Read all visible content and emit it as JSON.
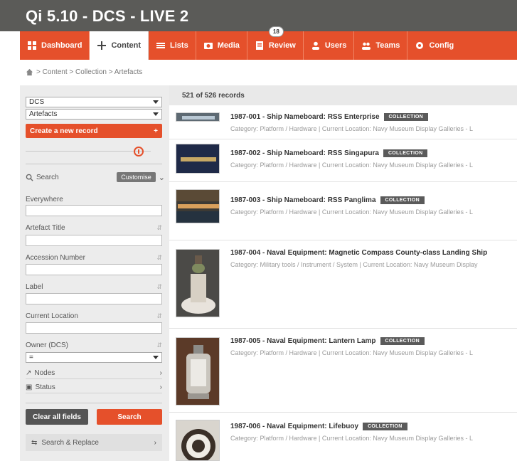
{
  "app": {
    "title": "Qi 5.10 - DCS - LIVE 2"
  },
  "nav": [
    {
      "label": "Dashboard",
      "icon": "dashboard-icon",
      "active": false
    },
    {
      "label": "Content",
      "icon": "plus-icon",
      "active": true
    },
    {
      "label": "Lists",
      "icon": "list-icon",
      "active": false
    },
    {
      "label": "Media",
      "icon": "camera-icon",
      "active": false
    },
    {
      "label": "Review",
      "icon": "review-icon",
      "active": false,
      "badge": "18"
    },
    {
      "label": "Users",
      "icon": "user-icon",
      "active": false
    },
    {
      "label": "Teams",
      "icon": "team-icon",
      "active": false
    },
    {
      "label": "Config",
      "icon": "gear-icon",
      "active": false
    }
  ],
  "breadcrumb": {
    "text": "> Content > Collection > Artefacts"
  },
  "sidebar": {
    "select1": "DCS",
    "select2": "Artefacts",
    "create_button": "Create a new record",
    "create_icon": "+",
    "search_label": "Search",
    "search_mode": "Customise",
    "fields": [
      {
        "label": "Everywhere",
        "sortable": false
      },
      {
        "label": "Artefact Title",
        "sortable": true
      },
      {
        "label": "Accession Number",
        "sortable": true
      },
      {
        "label": "Label",
        "sortable": true
      },
      {
        "label": "Current Location",
        "sortable": true
      }
    ],
    "owner_label": "Owner (DCS)",
    "owner_value": "=",
    "nodes_label": "Nodes",
    "status_label": "Status",
    "clear_button": "Clear all fields",
    "search_button": "Search",
    "search_replace": "Search & Replace"
  },
  "main": {
    "records_count": "521 of 526 records",
    "records": [
      {
        "title": "1987-001 - Ship Nameboard: RSS Enterprise",
        "badge": "COLLECTION",
        "meta": "Category: Platform / Hardware | Current Location: Navy Museum Display Galleries - L"
      },
      {
        "title": "1987-002 - Ship Nameboard: RSS Singapura",
        "badge": "COLLECTION",
        "meta": "Category: Platform / Hardware | Current Location: Navy Museum Display Galleries - L"
      },
      {
        "title": "1987-003 - Ship Nameboard: RSS Panglima",
        "badge": "COLLECTION",
        "meta": "Category: Platform / Hardware | Current Location: Navy Museum Display Galleries - L"
      },
      {
        "title": "1987-004 - Naval Equipment: Magnetic Compass County-class Landing Ship",
        "badge": "",
        "meta": "Category: Military tools / Instrument / System | Current Location: Navy Museum Display"
      },
      {
        "title": "1987-005 - Naval Equipment: Lantern Lamp",
        "badge": "COLLECTION",
        "meta": "Category: Platform / Hardware | Current Location: Navy Museum Display Galleries - L"
      },
      {
        "title": "1987-006 - Naval Equipment: Lifebuoy",
        "badge": "COLLECTION",
        "meta": "Category: Platform / Hardware | Current Location: Navy Museum Display Galleries - L"
      }
    ]
  },
  "colors": {
    "topbar": "#5b5b58",
    "accent": "#e5502b",
    "sidebar": "#ececec"
  }
}
